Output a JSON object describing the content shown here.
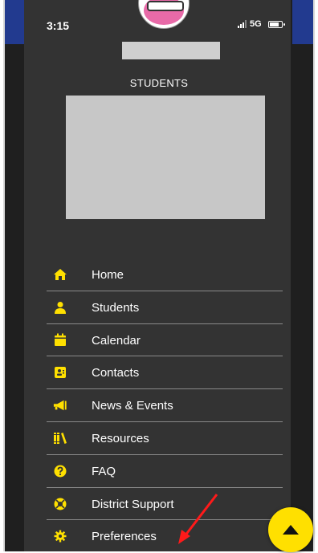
{
  "status_bar": {
    "time": "3:15",
    "network": "5G"
  },
  "drawer": {
    "section_title": "STUDENTS",
    "menu_items": [
      {
        "label": "Home",
        "icon": "home-icon"
      },
      {
        "label": "Students",
        "icon": "person-icon"
      },
      {
        "label": "Calendar",
        "icon": "calendar-icon"
      },
      {
        "label": "Contacts",
        "icon": "contact-card-icon"
      },
      {
        "label": "News & Events",
        "icon": "megaphone-icon"
      },
      {
        "label": "Resources",
        "icon": "books-icon"
      },
      {
        "label": "FAQ",
        "icon": "question-icon"
      },
      {
        "label": "District Support",
        "icon": "life-ring-icon"
      },
      {
        "label": "Preferences",
        "icon": "gear-icon"
      }
    ]
  },
  "fab": {
    "icon": "caret-up-icon"
  },
  "colors": {
    "accent": "#ffe000",
    "drawer_bg": "#333333",
    "annotation": "#ff1a1a"
  }
}
